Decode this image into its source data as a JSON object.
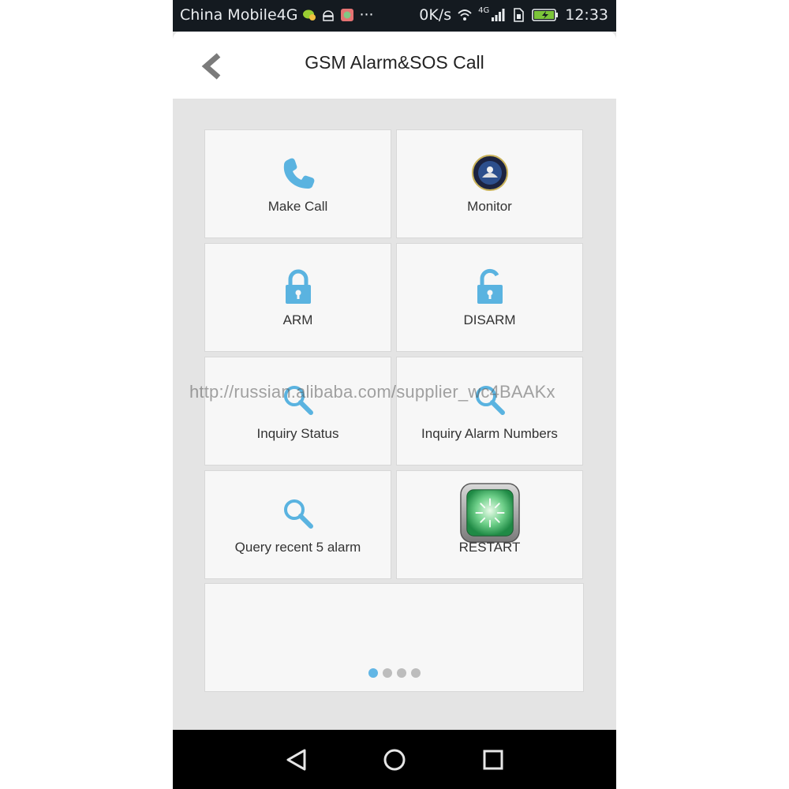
{
  "status_bar": {
    "carrier": "China Mobile4G",
    "dots": "···",
    "speed": "0K/s",
    "network": "4G",
    "time": "12:33"
  },
  "app_bar": {
    "title": "GSM Alarm&SOS Call",
    "back_icon": "chevron-left-icon"
  },
  "tiles": [
    {
      "label": "Make Call",
      "icon": "phone-icon"
    },
    {
      "label": "Monitor",
      "icon": "monitor-emblem-icon"
    },
    {
      "label": "ARM",
      "icon": "lock-closed-icon"
    },
    {
      "label": "DISARM",
      "icon": "lock-open-icon"
    },
    {
      "label": "Inquiry Status",
      "icon": "search-icon"
    },
    {
      "label": "Inquiry Alarm Numbers",
      "icon": "search-icon"
    },
    {
      "label": "Query recent 5 alarm",
      "icon": "search-icon"
    },
    {
      "label": "RESTART",
      "icon": "restart-icon"
    }
  ],
  "pager": {
    "total": 4,
    "active": 1
  },
  "watermark": "http://russian.alibaba.com/supplier_wc4BAAKx",
  "nav_bar": {
    "back_icon": "triangle-back-icon",
    "home_icon": "circle-home-icon",
    "recents_icon": "square-recents-icon"
  },
  "colors": {
    "accent": "#62b6e5",
    "status_bar_bg": "#141a20",
    "nav_bar_bg": "#000000",
    "content_bg": "#e4e4e4",
    "tile_bg": "#f7f7f7"
  }
}
